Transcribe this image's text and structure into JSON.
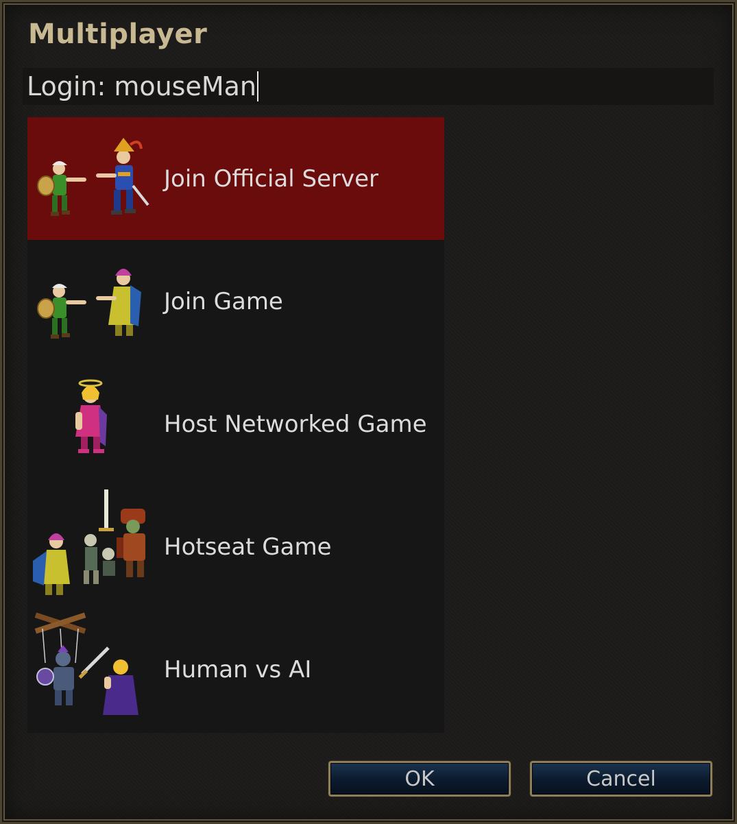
{
  "dialog": {
    "title": "Multiplayer"
  },
  "login": {
    "label": "Login:",
    "value": "mouseMan"
  },
  "menu": {
    "items": [
      {
        "label": "Join Official Server",
        "selected": true,
        "icon": "elf-and-knight-handshake-icon"
      },
      {
        "label": "Join Game",
        "selected": false,
        "icon": "elf-and-mage-handshake-icon"
      },
      {
        "label": "Host Networked Game",
        "selected": false,
        "icon": "princess-icon"
      },
      {
        "label": "Hotseat Game",
        "selected": false,
        "icon": "mage-undead-orc-group-icon"
      },
      {
        "label": "Human vs AI",
        "selected": false,
        "icon": "puppet-knight-and-mage-icon"
      }
    ]
  },
  "buttons": {
    "ok": "OK",
    "cancel": "Cancel"
  },
  "colors": {
    "title": "#c9b993",
    "selected_row": "#6b0c0c",
    "button_border": "#8d7f5a",
    "button_fill": "#0b1a2d"
  }
}
